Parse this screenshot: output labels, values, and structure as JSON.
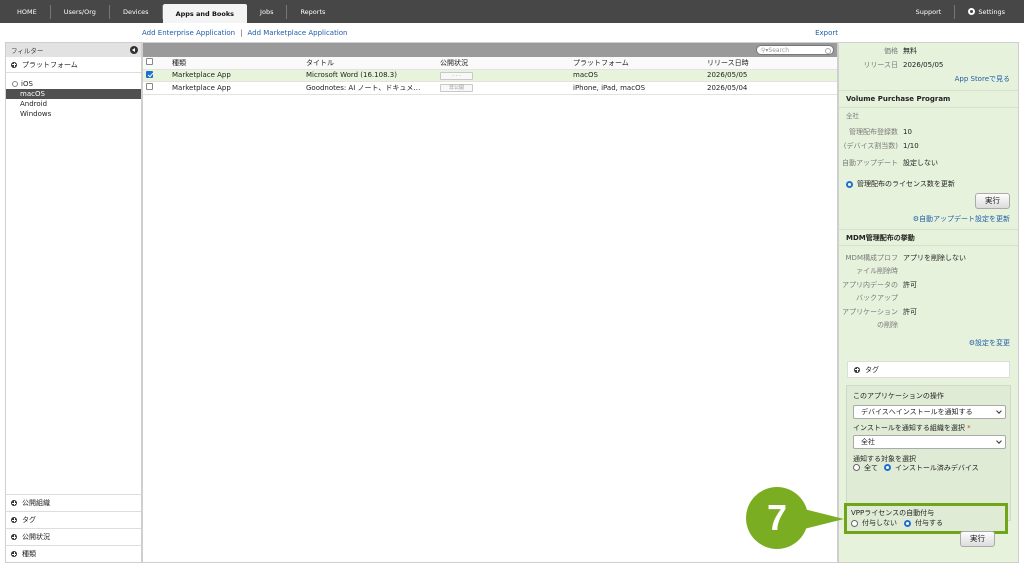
{
  "nav": {
    "items": [
      "HOME",
      "Users/Org",
      "Devices",
      "Apps and Books",
      "Jobs",
      "Reports"
    ],
    "active_index": 3,
    "support": "Support",
    "settings": "Settings"
  },
  "links": {
    "add_enterprise": "Add Enterprise Application",
    "add_marketplace": "Add Marketplace Application",
    "separator": "|",
    "export": "Export"
  },
  "filter": {
    "header": "フィルター",
    "platform_section": "プラットフォーム",
    "platforms": [
      "iOS",
      "macOS",
      "Android",
      "Windows"
    ],
    "selected_platform": "macOS",
    "bottom_sections": [
      "公開組織",
      "タグ",
      "公開状況",
      "種類"
    ]
  },
  "grid": {
    "search_placeholder": "Search",
    "columns": [
      "種類",
      "タイトル",
      "公開状況",
      "プラットフォーム",
      "リリース日時"
    ],
    "rows": [
      {
        "checked": true,
        "type": "Marketplace App",
        "title": "Microsoft Word (16.108.3)",
        "status": "- - -",
        "platform": "macOS",
        "date": "2026/05/05"
      },
      {
        "checked": false,
        "type": "Marketplace App",
        "title": "Goodnotes: AI ノート、ドキュメント…",
        "status": "非公開",
        "platform": "iPhone, iPad, macOS",
        "date": "2026/05/04"
      }
    ]
  },
  "detail": {
    "price_label": "価格",
    "price_value": "無料",
    "release_label": "リリース日",
    "release_value": "2026/05/05",
    "appstore_link": "App Storeで見る",
    "vpp_title": "Volume Purchase Program",
    "vpp_scope": "全社",
    "managed_count_label": "管理配布登録数",
    "managed_count_value": "10",
    "device_alloc_label": "(デバイス割当数)",
    "device_alloc_value": "1/10",
    "auto_update_label": "自動アップデート",
    "auto_update_value": "設定しない",
    "update_license_option": "管理配布のライセンス数を更新",
    "run_button": "実行",
    "auto_update_link": "自動アップデート設定を更新",
    "mdm_title": "MDM管理配布の挙動",
    "mdm_profile_label_1": "MDM構成プロフ",
    "mdm_profile_label_2": "ァイル削除時",
    "mdm_profile_value": "アプリを削除しない",
    "backup_label_1": "アプリ内データの",
    "backup_label_2": "バックアップ",
    "backup_value": "許可",
    "app_delete_label_1": "アプリケーション",
    "app_delete_label_2": "の削除",
    "app_delete_value": "許可",
    "change_settings_link": "設定を変更",
    "tag_label": "タグ",
    "ops_title": "このアプリケーションの操作",
    "ops_select": "デバイスへインストールを通知する",
    "org_label": "インストールを通知する組織を選択",
    "org_required": "*",
    "org_select": "全社",
    "target_label": "通知する対象を選択",
    "target_all": "全て",
    "target_installed": "インストール済みデバイス",
    "vpp_assign_title": "VPPライセンスの自動付与",
    "vpp_assign_no": "付与しない",
    "vpp_assign_yes": "付与する",
    "run_button_2": "実行"
  },
  "callout": {
    "number": "7"
  },
  "colors": {
    "accent_green": "#7aad22",
    "nav_bg": "#474747",
    "link_blue": "#1f5ea8"
  }
}
